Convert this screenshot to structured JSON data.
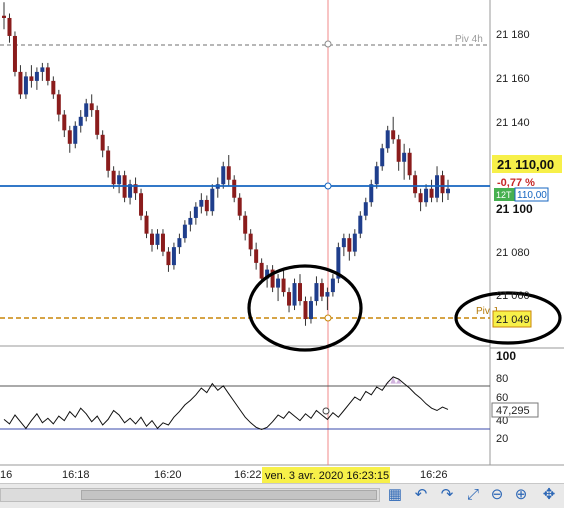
{
  "colors": {
    "candle_up": "#1f3e8c",
    "candle_down": "#8a1c1c",
    "price_line": "#1565c0",
    "pivot4h": "#8c8c8c",
    "pivot_day": "#c8860a",
    "cursor": "#f08a8a",
    "annotation": "#000000",
    "osc_level": "#3949ab",
    "osc_level_upper": "#555555"
  },
  "axis": {
    "price_labels": [
      "21 180",
      "21 160",
      "21 140",
      "21 100",
      "21 080",
      "21 060"
    ],
    "time_labels": [
      "16",
      "16:18",
      "16:20",
      "16:22",
      "16:26"
    ],
    "osc_labels": [
      "100",
      "80",
      "60",
      "40",
      "20"
    ]
  },
  "price_panel": {
    "pivot4h_label": "Piv 4h",
    "pivot_day_label": "Piv J",
    "pivot_day_value": "21 049",
    "last_price": "21 110,00",
    "change_pct": "-0,77 %",
    "timeframe": "12T",
    "timeframe_price": "110,00",
    "cursor_time": "ven. 3 avr. 2020 16:23:15"
  },
  "osc_panel": {
    "value": "47,295"
  },
  "toolbar": {
    "icons": [
      "grid-icon",
      "undo-icon",
      "redo-icon",
      "zoom-fit-icon",
      "zoom-out-icon",
      "zoom-in-icon",
      "drag-icon"
    ]
  },
  "chart_data": [
    {
      "type": "candlestick",
      "ylim": [
        21040,
        21194
      ],
      "x": [
        "16",
        "16:18",
        "16:20",
        "16:22",
        "16:26"
      ],
      "pivots": {
        "Piv 4h": 21175,
        "Piv J": 21049
      },
      "last": 21110,
      "ohlc": [
        [
          21187,
          21193,
          21181,
          21186
        ],
        [
          21186,
          21188,
          21175,
          21178
        ],
        [
          21178,
          21180,
          21160,
          21162
        ],
        [
          21162,
          21165,
          21150,
          21152
        ],
        [
          21152,
          21162,
          21150,
          21160
        ],
        [
          21160,
          21165,
          21155,
          21158
        ],
        [
          21158,
          21164,
          21154,
          21162
        ],
        [
          21162,
          21166,
          21158,
          21164
        ],
        [
          21164,
          21166,
          21156,
          21158
        ],
        [
          21158,
          21160,
          21150,
          21152
        ],
        [
          21152,
          21154,
          21140,
          21143
        ],
        [
          21143,
          21145,
          21133,
          21136
        ],
        [
          21136,
          21138,
          21126,
          21130
        ],
        [
          21130,
          21140,
          21128,
          21138
        ],
        [
          21138,
          21145,
          21135,
          21142
        ],
        [
          21142,
          21150,
          21140,
          21148
        ],
        [
          21148,
          21152,
          21142,
          21145
        ],
        [
          21145,
          21147,
          21132,
          21134
        ],
        [
          21134,
          21136,
          21124,
          21127
        ],
        [
          21127,
          21129,
          21115,
          21118
        ],
        [
          21118,
          21120,
          21110,
          21112
        ],
        [
          21112,
          21118,
          21108,
          21116
        ],
        [
          21116,
          21118,
          21104,
          21106
        ],
        [
          21106,
          21114,
          21103,
          21112
        ],
        [
          21112,
          21115,
          21105,
          21108
        ],
        [
          21108,
          21110,
          21096,
          21098
        ],
        [
          21098,
          21100,
          21088,
          21090
        ],
        [
          21090,
          21092,
          21082,
          21085
        ],
        [
          21085,
          21092,
          21083,
          21090
        ],
        [
          21090,
          21092,
          21080,
          21082
        ],
        [
          21082,
          21084,
          21073,
          21076
        ],
        [
          21076,
          21086,
          21074,
          21084
        ],
        [
          21084,
          21090,
          21081,
          21088
        ],
        [
          21088,
          21096,
          21086,
          21094
        ],
        [
          21094,
          21100,
          21091,
          21097
        ],
        [
          21097,
          21104,
          21094,
          21102
        ],
        [
          21102,
          21108,
          21099,
          21105
        ],
        [
          21105,
          21107,
          21098,
          21100
        ],
        [
          21100,
          21112,
          21098,
          21110
        ],
        [
          21110,
          21115,
          21106,
          21112
        ],
        [
          21112,
          21122,
          21110,
          21120
        ],
        [
          21120,
          21125,
          21111,
          21114
        ],
        [
          21114,
          21116,
          21104,
          21106
        ],
        [
          21106,
          21108,
          21096,
          21098
        ],
        [
          21098,
          21100,
          21087,
          21090
        ],
        [
          21090,
          21092,
          21080,
          21083
        ],
        [
          21083,
          21086,
          21074,
          21077
        ],
        [
          21077,
          21079,
          21068,
          21070
        ],
        [
          21070,
          21076,
          21066,
          21074
        ],
        [
          21074,
          21076,
          21064,
          21066
        ],
        [
          21066,
          21072,
          21060,
          21070
        ],
        [
          21070,
          21074,
          21062,
          21064
        ],
        [
          21064,
          21066,
          21055,
          21058
        ],
        [
          21058,
          21070,
          21056,
          21068
        ],
        [
          21068,
          21072,
          21058,
          21060
        ],
        [
          21060,
          21062,
          21049,
          21052
        ],
        [
          21052,
          21062,
          21050,
          21060
        ],
        [
          21060,
          21071,
          21058,
          21068
        ],
        [
          21068,
          21070,
          21060,
          21062
        ],
        [
          21062,
          21066,
          21056,
          21064
        ],
        [
          21064,
          21072,
          21062,
          21070
        ],
        [
          21070,
          21086,
          21068,
          21084
        ],
        [
          21084,
          21090,
          21080,
          21088
        ],
        [
          21088,
          21090,
          21078,
          21082
        ],
        [
          21082,
          21092,
          21080,
          21090
        ],
        [
          21090,
          21100,
          21088,
          21098
        ],
        [
          21098,
          21106,
          21096,
          21104
        ],
        [
          21104,
          21114,
          21102,
          21112
        ],
        [
          21112,
          21122,
          21110,
          21120
        ],
        [
          21120,
          21130,
          21118,
          21128
        ],
        [
          21128,
          21138,
          21126,
          21136
        ],
        [
          21136,
          21142,
          21130,
          21132
        ],
        [
          21132,
          21134,
          21118,
          21122
        ],
        [
          21122,
          21130,
          21114,
          21126
        ],
        [
          21126,
          21128,
          21114,
          21116
        ],
        [
          21116,
          21118,
          21106,
          21108
        ],
        [
          21108,
          21110,
          21100,
          21104
        ],
        [
          21104,
          21112,
          21102,
          21110
        ],
        [
          21110,
          21114,
          21104,
          21106
        ],
        [
          21106,
          21120,
          21104,
          21116
        ],
        [
          21116,
          21118,
          21104,
          21108
        ],
        [
          21108,
          21114,
          21105,
          21110
        ]
      ]
    },
    {
      "type": "line",
      "ylim": [
        0,
        100
      ],
      "levels": [
        70,
        30
      ],
      "last": 47.295,
      "values": [
        38,
        34,
        42,
        36,
        30,
        37,
        43,
        35,
        39,
        34,
        41,
        37,
        45,
        40,
        48,
        43,
        36,
        41,
        33,
        38,
        46,
        42,
        35,
        39,
        34,
        40,
        32,
        37,
        30,
        35,
        33,
        40,
        45,
        51,
        55,
        60,
        66,
        62,
        70,
        64,
        68,
        61,
        54,
        47,
        40,
        35,
        31,
        29,
        31,
        36,
        42,
        39,
        45,
        41,
        37,
        43,
        39,
        46,
        42,
        38,
        44,
        40,
        46,
        52,
        58,
        55,
        63,
        60,
        67,
        64,
        71,
        76,
        74,
        70,
        66,
        61,
        57,
        52,
        48,
        46,
        49,
        47
      ]
    }
  ]
}
